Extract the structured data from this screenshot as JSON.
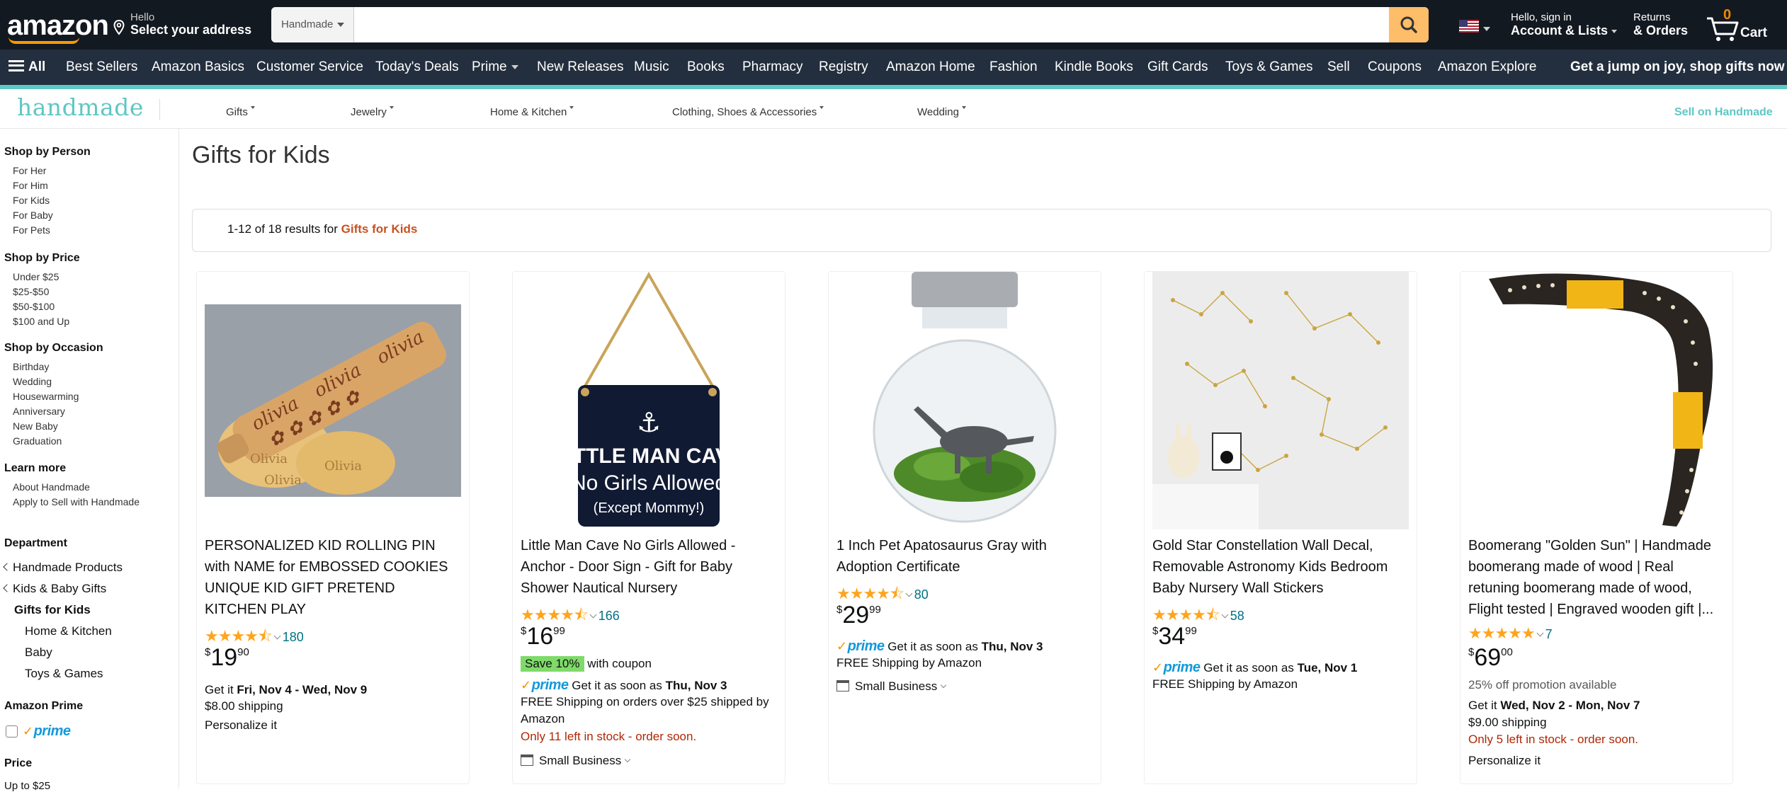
{
  "header": {
    "logo": "amazon",
    "deliver_line1": "Hello",
    "deliver_line2": "Select your address",
    "search_dept": "Handmade",
    "search_placeholder": "",
    "account_line1": "Hello, sign in",
    "account_line2": "Account & Lists",
    "returns_line1": "Returns",
    "returns_line2": "& Orders",
    "cart_count": "0",
    "cart_label": "Cart"
  },
  "subnav": {
    "all": "All",
    "items": [
      "Best Sellers",
      "Amazon Basics",
      "Customer Service",
      "Today's Deals",
      "Prime",
      "New Releases",
      "Music",
      "Books",
      "Pharmacy",
      "Registry",
      "Amazon Home",
      "Fashion",
      "Kindle Books",
      "Gift Cards",
      "Toys & Games",
      "Sell",
      "Coupons",
      "Amazon Explore"
    ],
    "promo": "Get a jump on joy, shop gifts now"
  },
  "handmade": {
    "logo": "handmade",
    "menu": [
      "Gifts",
      "Jewelry",
      "Home & Kitchen",
      "Clothing, Shoes & Accessories",
      "Wedding"
    ],
    "sell": "Sell on Handmade"
  },
  "sidebar": {
    "person_heading": "Shop by Person",
    "person": [
      "For Her",
      "For Him",
      "For Kids",
      "For Baby",
      "For Pets"
    ],
    "price_heading": "Shop by Price",
    "price": [
      "Under $25",
      "$25-$50",
      "$50-$100",
      "$100 and Up"
    ],
    "occasion_heading": "Shop by Occasion",
    "occasion": [
      "Birthday",
      "Wedding",
      "Housewarming",
      "Anniversary",
      "New Baby",
      "Graduation"
    ],
    "learn_heading": "Learn more",
    "learn": [
      "About Handmade",
      "Apply to Sell with Handmade"
    ],
    "dept_heading": "Department",
    "dept_parents": [
      "Handmade Products",
      "Kids & Baby Gifts"
    ],
    "dept_current": "Gifts for Kids",
    "dept_children": [
      "Home & Kitchen",
      "Baby",
      "Toys & Games"
    ],
    "prime_heading": "Amazon Prime",
    "prime_label": "prime",
    "price_filter_heading": "Price",
    "price_filter_first": "Up to $25"
  },
  "main": {
    "title": "Gifts for Kids",
    "results_prefix": "1-12 of 18 results for ",
    "results_query": "Gifts for Kids"
  },
  "products": [
    {
      "title": "PERSONALIZED KID ROLLING PIN with NAME for EMBOSSED COOKIES UNIQUE KID GIFT PRETEND KITCHEN PLAY",
      "rating": 4.5,
      "reviews": "180",
      "price_sym": "$",
      "price_whole": "19",
      "price_frac": "90",
      "lines": [
        {
          "pre": "Get it ",
          "bold": "Fri, Nov 4 - Wed, Nov 9",
          "post": ""
        },
        {
          "text": "$8.00 shipping"
        },
        {
          "text": "Personalize it"
        }
      ]
    },
    {
      "title": "Little Man Cave No Girls Allowed - Anchor - Door Sign - Gift for Baby Shower Nautical Nursery",
      "rating": 4.5,
      "reviews": "166",
      "price_sym": "$",
      "price_whole": "16",
      "price_frac": "99",
      "save_badge": "Save 10%",
      "coupon_text": " with coupon",
      "prime_text": "Get it as soon as ",
      "prime_bold": "Thu, Nov 3",
      "free_ship": "FREE Shipping on orders over $25 shipped by",
      "free_ship2": "Amazon",
      "stock": "Only 11 left in stock - order soon.",
      "small_business": "Small Business"
    },
    {
      "title": "1 Inch Pet Apatosaurus Gray with Adoption Certificate",
      "rating": 4.5,
      "reviews": "80",
      "price_sym": "$",
      "price_whole": "29",
      "price_frac": "99",
      "prime_text": "Get it as soon as ",
      "prime_bold": "Thu, Nov 3",
      "free_ship": "FREE Shipping by Amazon",
      "small_business": "Small Business"
    },
    {
      "title": "Gold Star Constellation Wall Decal, Removable Astronomy Kids Bedroom Baby Nursery Wall Stickers",
      "rating": 4.5,
      "reviews": "58",
      "price_sym": "$",
      "price_whole": "34",
      "price_frac": "99",
      "prime_text": "Get it as soon as ",
      "prime_bold": "Tue, Nov 1",
      "free_ship": "FREE Shipping by Amazon"
    },
    {
      "title": "Boomerang \"Golden Sun\" | Handmade boomerang made of wood | Real retuning boomerang made of wood, Flight tested | Engraved wooden gift |...",
      "rating": 5,
      "reviews": "7",
      "price_sym": "$",
      "price_whole": "69",
      "price_frac": "00",
      "promo": "25% off promotion available",
      "get_pre": "Get it ",
      "get_bold": "Wed, Nov 2 - Mon, Nov 7",
      "shipping": "$9.00 shipping",
      "stock": "Only 5 left in stock - order soon.",
      "personalize": "Personalize it"
    }
  ],
  "product_images": [
    "rolling-pin",
    "door-sign",
    "dinosaur-terrarium",
    "constellation-decal",
    "boomerang"
  ],
  "sign_text": [
    "LITTLE MAN CAVE",
    "No Girls Allowed",
    "(Except Mommy!)"
  ],
  "rolling_pin_text": [
    "olivia",
    "olivia",
    "olivia",
    "Olivia",
    "Olivia",
    "Olivia"
  ],
  "colors": {
    "nav": "#131921",
    "subnav": "#232f3e",
    "accent": "#febd69",
    "handmade": "#5fc7c4",
    "link": "#007185",
    "star": "#ffa41c",
    "price_red": "#b12704",
    "query": "#c7511f"
  }
}
